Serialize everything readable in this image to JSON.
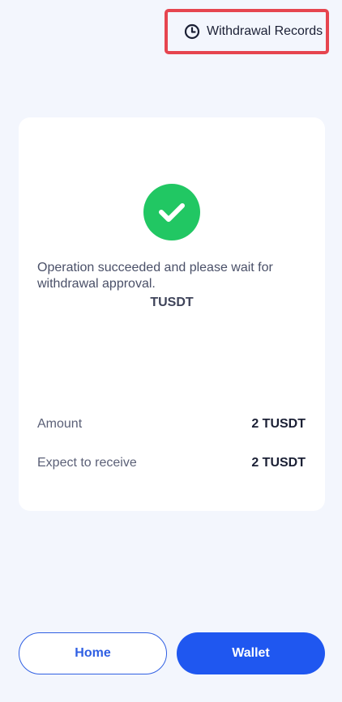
{
  "header": {
    "records_label": "Withdrawal Records",
    "records_icon": "clock-icon"
  },
  "result": {
    "icon": "check-icon",
    "status_color": "#21c763",
    "message": "Operation succeeded and please wait for withdrawal approval.",
    "currency": "TUSDT"
  },
  "details": [
    {
      "label": "Amount",
      "value": "2 TUSDT"
    },
    {
      "label": "Expect to receive",
      "value": "2 TUSDT"
    }
  ],
  "actions": {
    "home_label": "Home",
    "wallet_label": "Wallet",
    "accent_color": "#1f57f0"
  }
}
